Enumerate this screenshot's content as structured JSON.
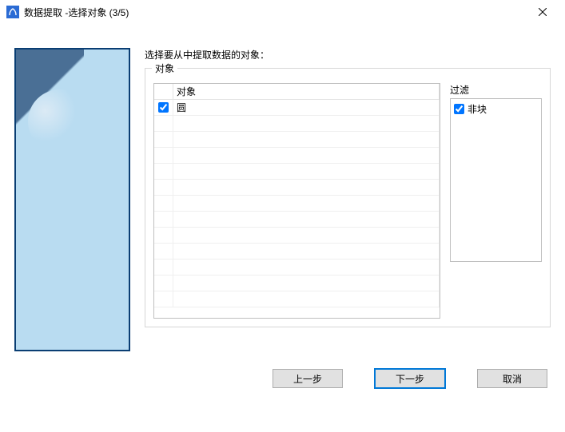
{
  "window": {
    "title": "数据提取 -选择对象 (3/5)"
  },
  "instruction": "选择要从中提取数据的对象：",
  "objects_group": {
    "label": "对象",
    "header": "对象",
    "rows": [
      {
        "label": "圆",
        "checked": true
      }
    ]
  },
  "filter": {
    "label": "过滤",
    "items": [
      {
        "label": "非块",
        "checked": true
      }
    ]
  },
  "buttons": {
    "back": "上一步",
    "next": "下一步",
    "cancel": "取消"
  }
}
